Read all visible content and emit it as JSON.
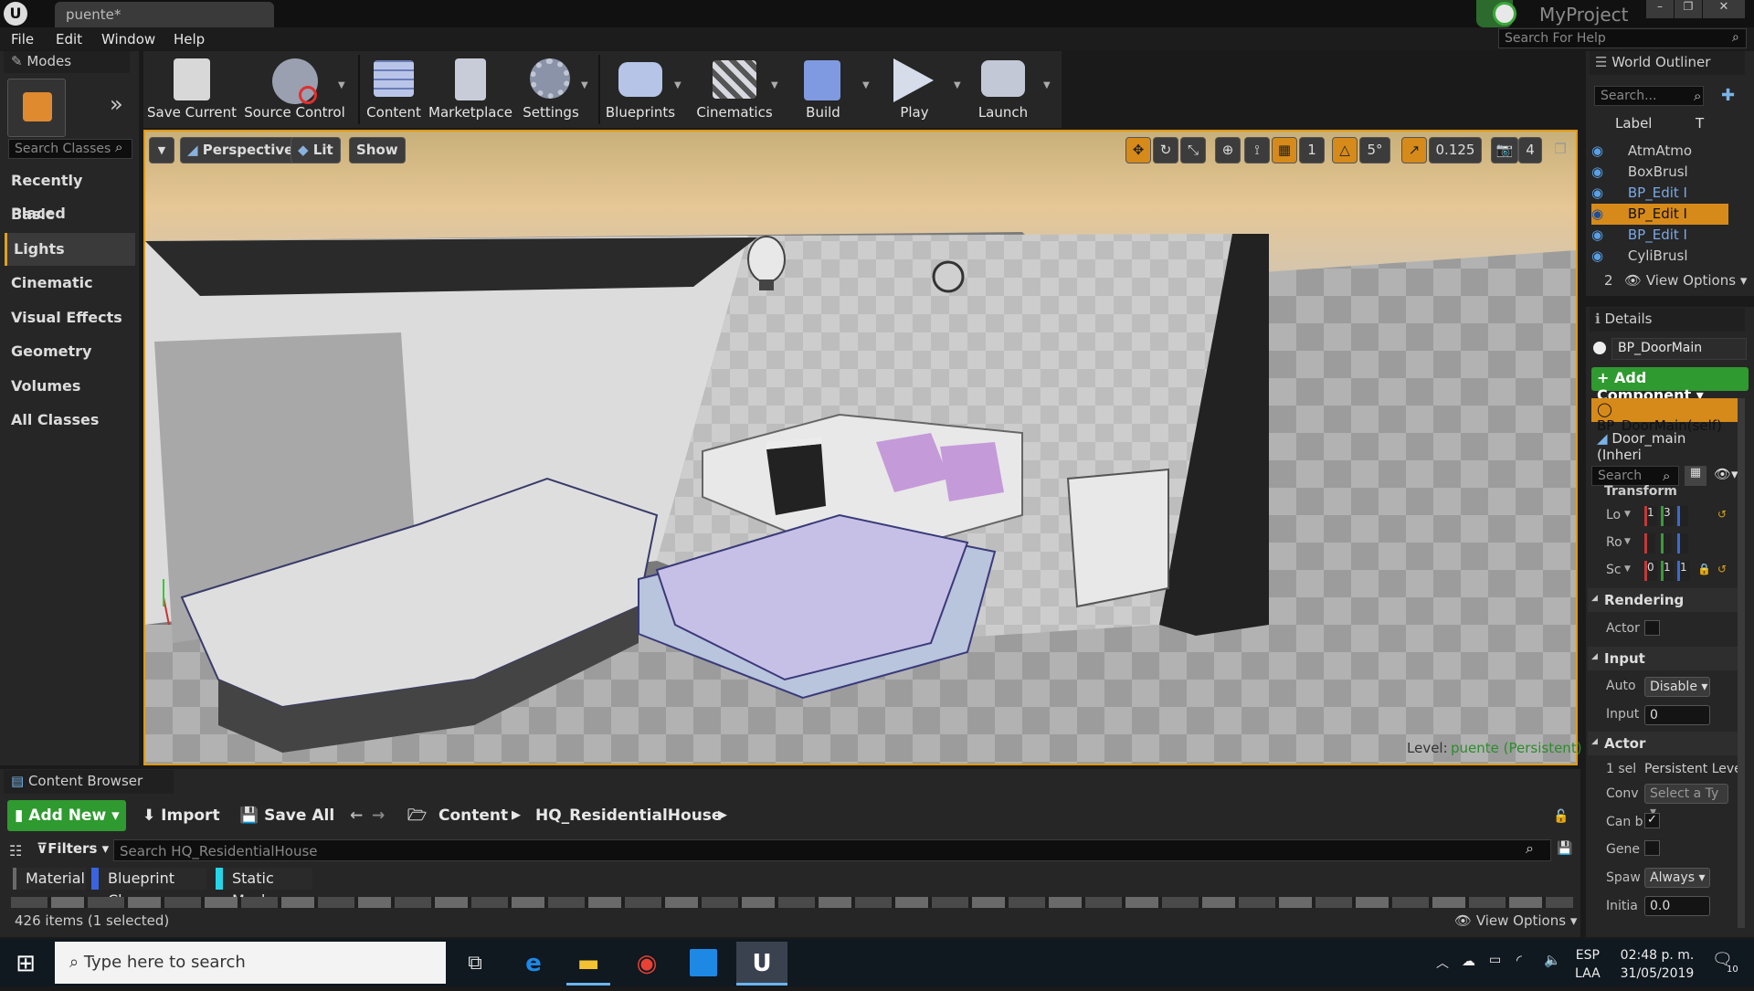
{
  "window": {
    "tab_title": "puente*",
    "project_name": "MyProject",
    "help_search_placeholder": "Search For Help"
  },
  "menu": [
    "File",
    "Edit",
    "Window",
    "Help"
  ],
  "modes": {
    "tab_label": "Modes",
    "search_placeholder": "Search Classes",
    "categories": [
      "Recently Placed",
      "Basic",
      "Lights",
      "Cinematic",
      "Visual Effects",
      "Geometry",
      "Volumes",
      "All Classes"
    ],
    "selected_category": "Lights"
  },
  "toolbar": {
    "save_current": "Save Current",
    "source_control": "Source Control",
    "content": "Content",
    "marketplace": "Marketplace",
    "settings": "Settings",
    "blueprints": "Blueprints",
    "cinematics": "Cinematics",
    "build": "Build",
    "play": "Play",
    "launch": "Launch"
  },
  "viewport": {
    "perspective_label": "Perspective",
    "lit_label": "Lit",
    "show_label": "Show",
    "grid_snap": "1",
    "rotation_snap": "5°",
    "scale_snap": "0.125",
    "camera_speed": "4",
    "level_label": "Level:",
    "level_name": "puente (Persistent)"
  },
  "world_outliner": {
    "tab_label": "World Outliner",
    "search_placeholder": "Search...",
    "col_label": "Label",
    "col_type": "T",
    "rows": [
      {
        "name": "AtmAtmo",
        "selected": false
      },
      {
        "name": "BoxBrusl",
        "selected": false
      },
      {
        "name": "BP_Edit I",
        "selected": false
      },
      {
        "name": "BP_Edit I",
        "selected": true
      },
      {
        "name": "BP_Edit I",
        "selected": false
      },
      {
        "name": "CyliBrusl",
        "selected": false
      }
    ],
    "count": "2",
    "view_options": "View Options"
  },
  "details": {
    "tab_label": "Details",
    "actor_name": "BP_DoorMain",
    "add_component": "+ Add Component",
    "components": [
      "BP_DoorMain(self)",
      "Door_main (Inheri"
    ],
    "search_placeholder": "Search",
    "transform_section": "Transform",
    "transform_rows": [
      "Lo",
      "Ro",
      "Sc"
    ],
    "location_values": [
      "1",
      "3"
    ],
    "scale_values": [
      "0",
      "1",
      "1"
    ],
    "rendering_section": "Rendering",
    "rendering_actor_label": "Actor",
    "input_section": "Input",
    "input_auto_label": "Auto",
    "input_auto_value": "Disable",
    "input_input_label": "Input",
    "input_input_value": "0",
    "actor_section": "Actor",
    "actor_selected_label": "1 sel",
    "actor_selected_value": "Persistent Leve",
    "conv_label": "Conv",
    "conv_value": "Select a Ty",
    "canb_label": "Can b",
    "gene_label": "Gene",
    "spaw_label": "Spaw",
    "spaw_value": "Always",
    "initia_label": "Initia",
    "initia_value": "0.0"
  },
  "content_browser": {
    "tab_label": "Content Browser",
    "add_new": "Add New",
    "import": "Import",
    "save_all": "Save All",
    "path": [
      "Content",
      "HQ_ResidentialHouse"
    ],
    "filters": "Filters",
    "search_placeholder": "Search HQ_ResidentialHouse",
    "filter_tags": [
      {
        "label": "Material",
        "color": "#6a6a6a"
      },
      {
        "label": "Blueprint Class",
        "color": "#3a63e0"
      },
      {
        "label": "Static Mesh",
        "color": "#25d6e8"
      }
    ],
    "status": "426 items (1 selected)",
    "view_options": "View Options"
  },
  "taskbar": {
    "search_placeholder": "Type here to search",
    "language": "ESP",
    "layout": "LAA",
    "time": "02:48 p. m.",
    "date": "31/05/2019",
    "notifications": "10"
  },
  "colors": {
    "accent_green": "#2f9a2f",
    "selection_orange": "#d68a1a",
    "level_link": "#6fd26f"
  }
}
